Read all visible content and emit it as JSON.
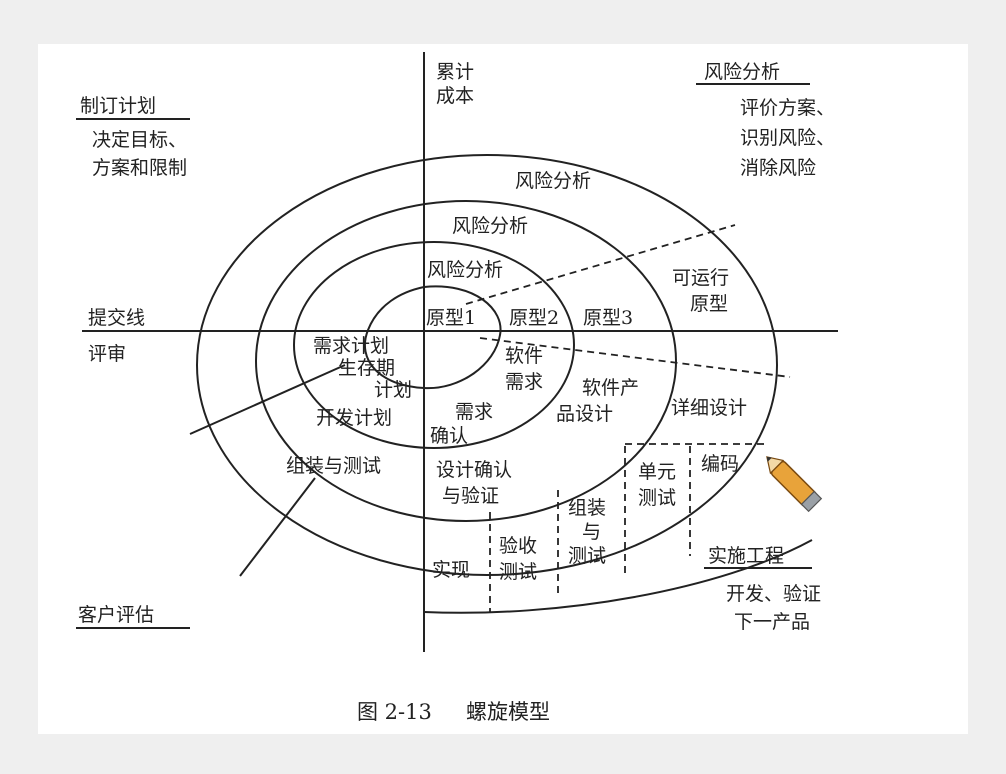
{
  "diagram": {
    "axis_top_label": [
      "累计",
      "成本"
    ],
    "top_left": {
      "title": "制订计划",
      "lines": [
        "决定目标、",
        "方案和限制"
      ]
    },
    "top_right": {
      "title": "风险分析",
      "lines": [
        "评价方案、",
        "识别风险、",
        "消除风险"
      ]
    },
    "left_axis": {
      "commit_label": "提交线",
      "review_label": "评审"
    },
    "bottom_left": {
      "title": "客户评估"
    },
    "bottom_right": {
      "title": "实施工程",
      "lines": [
        "开发、验证",
        "下一产品"
      ]
    },
    "risk_labels": [
      "风险分析",
      "风险分析",
      "风险分析"
    ],
    "prototypes": [
      "原型1",
      "原型2",
      "原型3"
    ],
    "operational_prototype": [
      "可运行",
      "原型"
    ],
    "plans": {
      "requirements_plan": "需求计划",
      "lifecycle_plan": [
        "生存期",
        "计划"
      ],
      "development_plan": "开发计划",
      "integration_test_plan": "组装与测试"
    },
    "engineering": {
      "software_requirements": [
        "软件",
        "需求"
      ],
      "requirements_validation": [
        "需求",
        "确认"
      ],
      "product_design": [
        "软件产",
        "品设计"
      ],
      "design_verification": [
        "设计确认",
        "与验证"
      ],
      "detailed_design": "详细设计",
      "unit_test": [
        "单元",
        "测试"
      ],
      "coding": "编码",
      "integration_test": [
        "组装",
        "与",
        "测试"
      ],
      "acceptance_test": [
        "验收",
        "测试"
      ],
      "implementation": "实现"
    },
    "caption": {
      "number": "图 2-13",
      "title": "螺旋模型"
    }
  }
}
